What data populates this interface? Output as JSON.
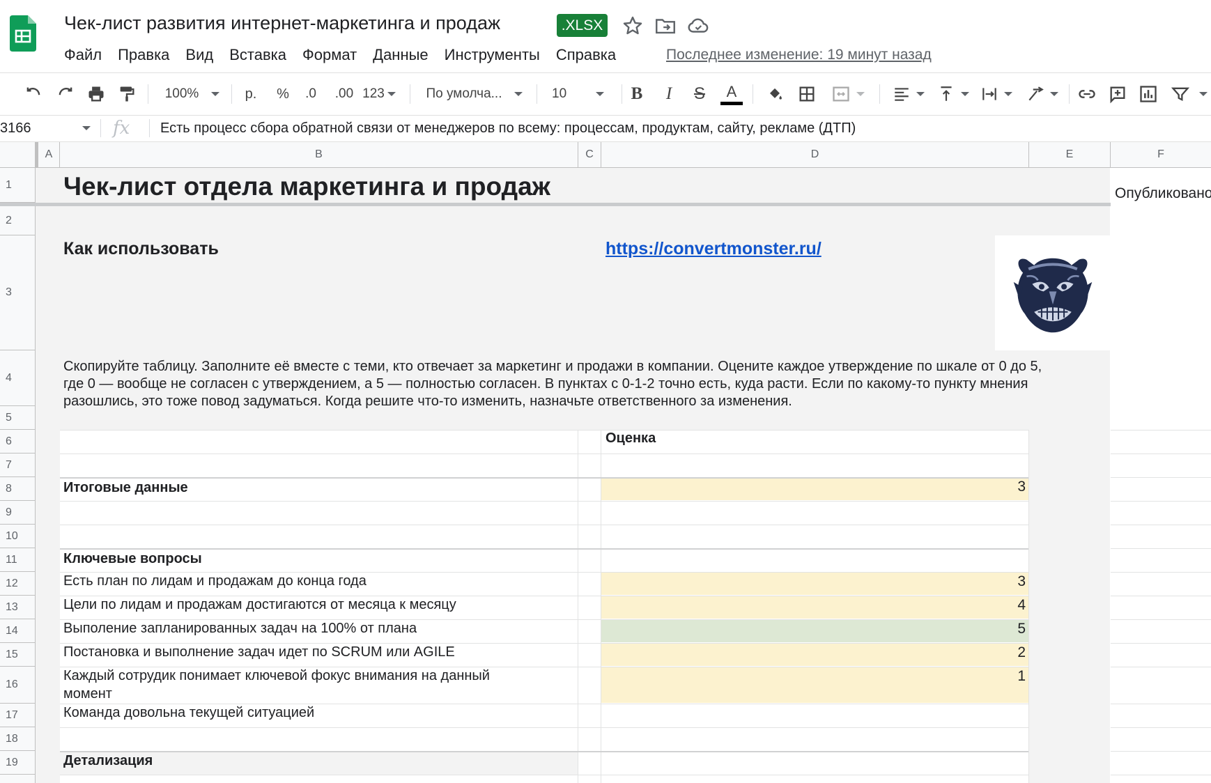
{
  "header": {
    "title": "Чек-лист развития интернет-маркетинга и продаж",
    "badge": ".XLSX",
    "last_edit": "Последнее изменение: 19 минут назад"
  },
  "menu": [
    "Файл",
    "Правка",
    "Вид",
    "Вставка",
    "Формат",
    "Данные",
    "Инструменты",
    "Справка"
  ],
  "toolbar": {
    "zoom": "100%",
    "currency": "р.",
    "percent": "%",
    "dec_less": ".0",
    "dec_more": ".00",
    "format_more": "123",
    "font": "По умолча...",
    "font_size": "10"
  },
  "formula_bar": {
    "cell_ref": "3166",
    "fx": "fx",
    "formula": "Есть процесс сбора обратной связи от менеджеров по всему: процессам, продуктам, сайту, рекламе (ДТП)"
  },
  "columns": [
    "A",
    "B",
    "C",
    "D",
    "E",
    "F"
  ],
  "rows": [
    "1",
    "2",
    "3",
    "4",
    "5",
    "6",
    "7",
    "8",
    "9",
    "10",
    "11",
    "12",
    "13",
    "14",
    "15",
    "16",
    "17",
    "18",
    "19"
  ],
  "sheet": {
    "title": "Чек-лист отдела маркетинга и продаж",
    "published_cut": "Опубликовано",
    "how_to": "Как использовать",
    "link": "https://convertmonster.ru/",
    "instructions_1": "Скопируйте таблицу. Заполните её вместе с теми, кто отвечает за маркетинг и продажи в компании. Оцените каждое утверждение по шкале от 0 до 5,",
    "instructions_2": "где 0 — вообще не согласен с утверждением, а 5 — полностью согласен. В пунктах с 0-1-2 точно есть, куда расти. Если по какому-то пункту мнения",
    "instructions_3": "разошлись, это тоже повод задуматься. Когда решите что-то изменить, назначьте ответственного за изменения.",
    "score_header": "Оценка",
    "total_label": "Итоговые данные",
    "total_value": "3",
    "key_questions": "Ключевые вопросы",
    "items": [
      {
        "label": "Есть план по лидам и продажам до конца года",
        "value": "3",
        "color": "#fcf2cf"
      },
      {
        "label": "Цели по лидам и продажам достигаются от месяца к месяцу",
        "value": "4",
        "color": "#fcf2cf"
      },
      {
        "label": "Выполение запланированных задач на 100% от плана",
        "value": "5",
        "color": "#dde8d4"
      },
      {
        "label": "Постановка и выполнение задач идет по SCRUM или AGILE",
        "value": "2",
        "color": "#fcf2cf"
      },
      {
        "label": "Каждый сотрудик понимает ключевой фокус внимания на данный",
        "label2": "момент",
        "value": "1",
        "color": "#fcf2cf"
      },
      {
        "label": "Команда довольна текущей ситуацией",
        "value": "",
        "color": "#ffffff"
      }
    ],
    "detail": "Детализация"
  },
  "colors": {
    "accent_green": "#188038",
    "link_blue": "#1155cc",
    "sheet_gray": "#f3f3f3",
    "score_yellow": "#fcf2cf",
    "score_green": "#dde8d4"
  }
}
